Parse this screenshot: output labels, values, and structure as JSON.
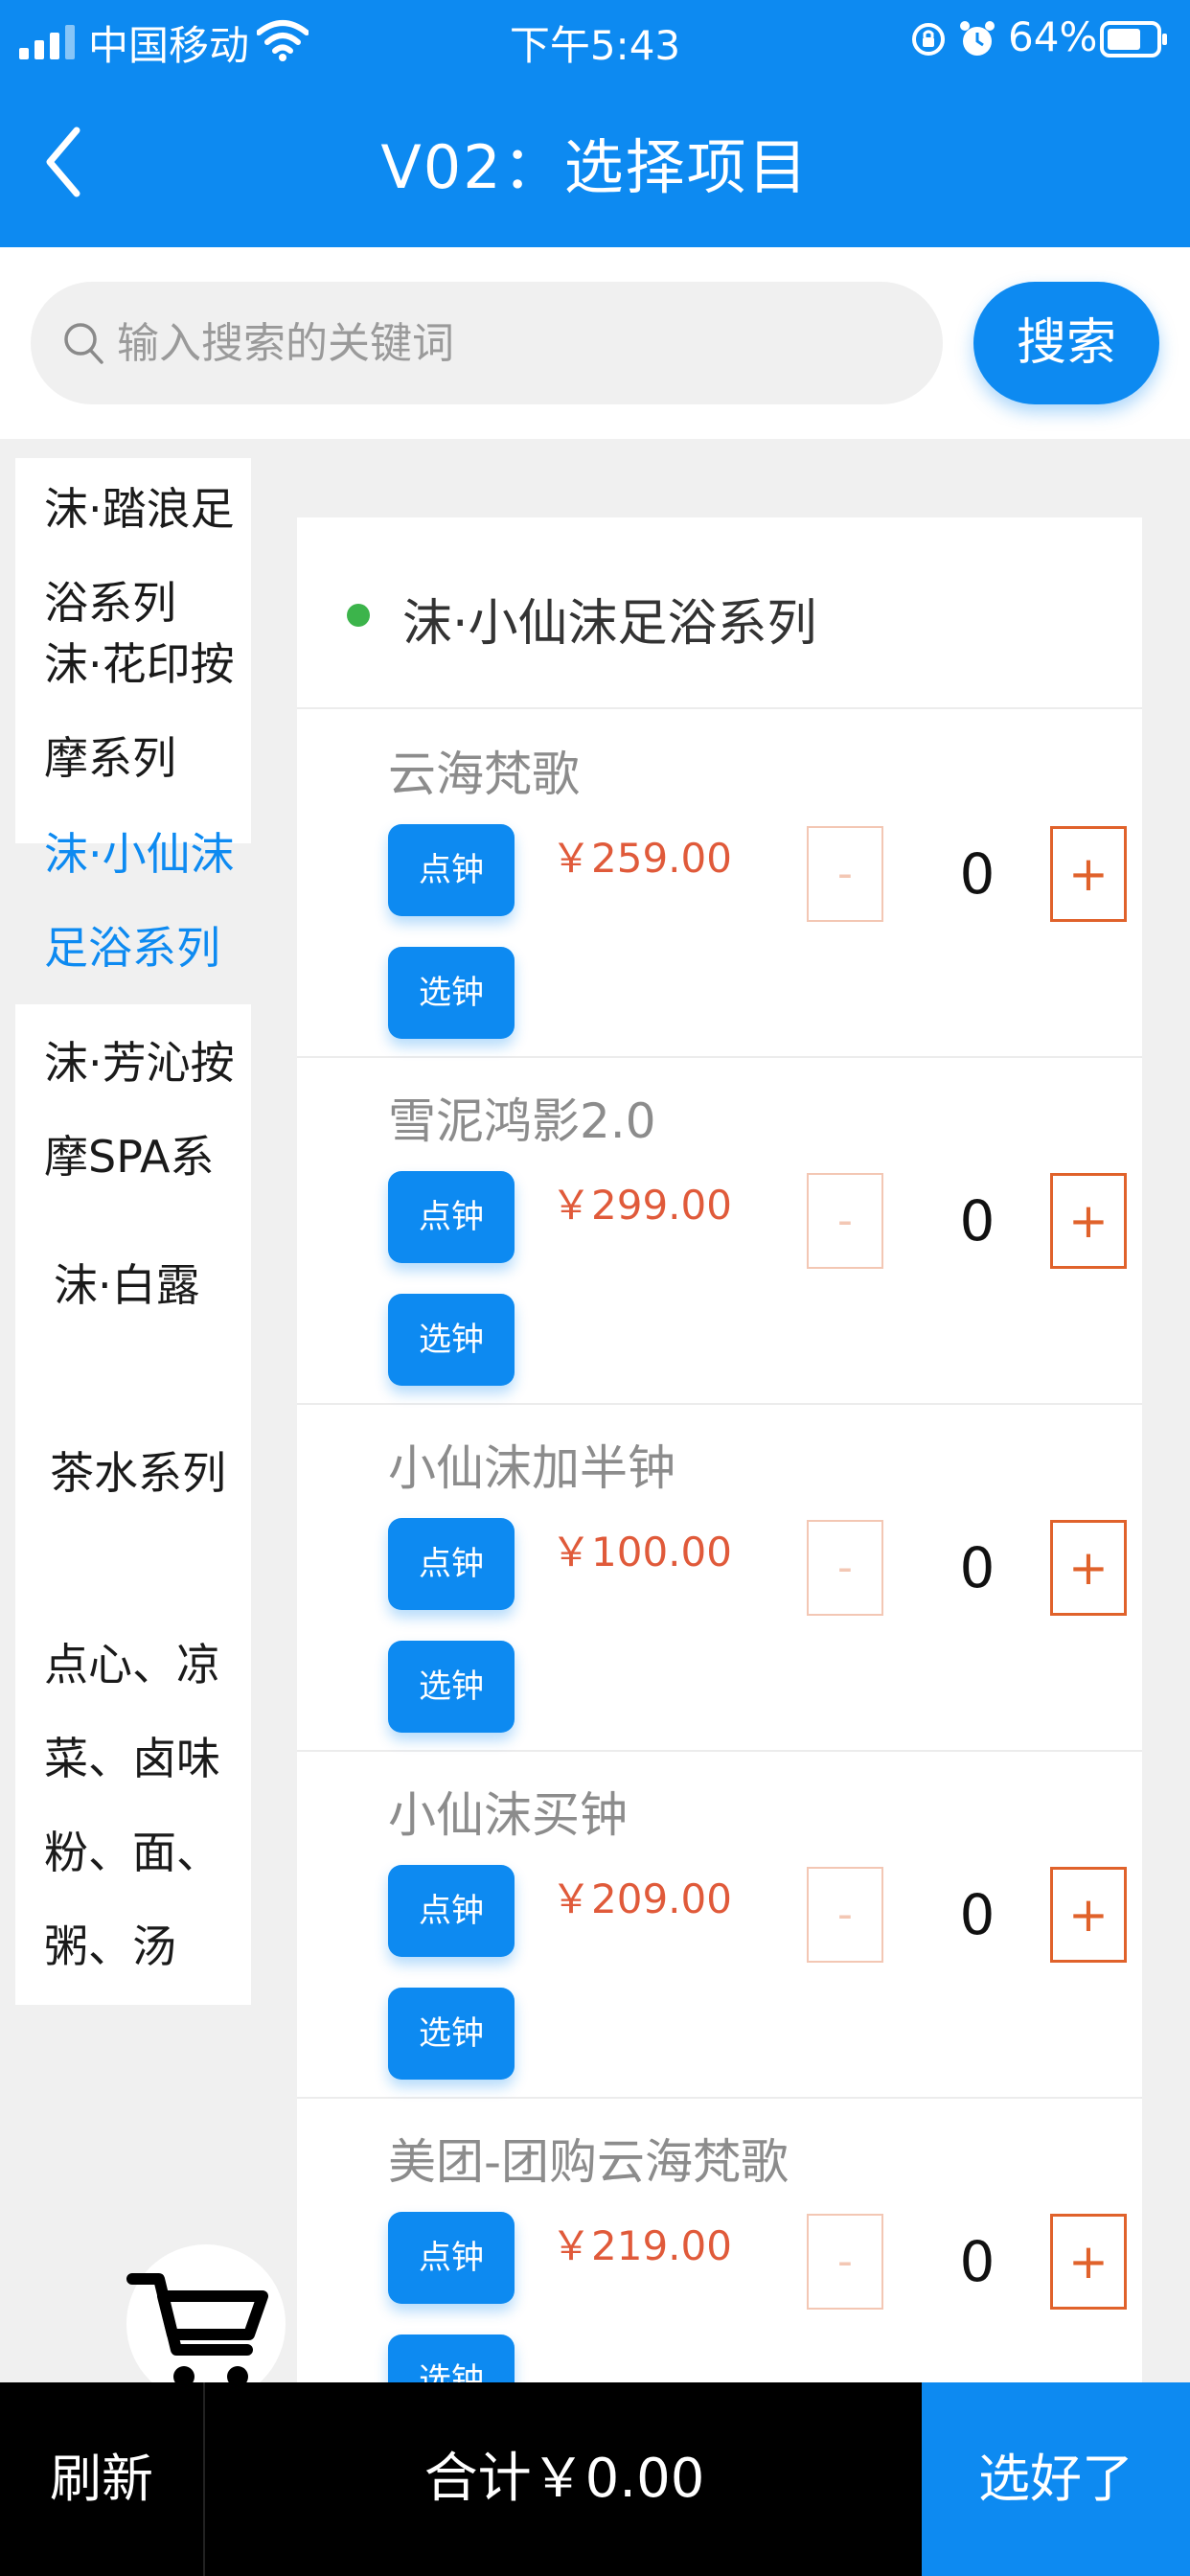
{
  "status_bar": {
    "carrier": "中国移动",
    "time": "下午5:43",
    "battery": "64%"
  },
  "header": {
    "title": "V02：选择项目"
  },
  "search": {
    "placeholder": "输入搜索的关键词",
    "value": "",
    "button_label": "搜索"
  },
  "categories": [
    {
      "label": "沫·踏浪足浴系列",
      "active": false
    },
    {
      "label": "沫·花印按摩系列",
      "active": false
    },
    {
      "label": "沫·小仙沫足浴系列",
      "active": true
    },
    {
      "label": "沫·芳沁按摩SPA系列",
      "active": false
    },
    {
      "label": "沫·白露",
      "active": false
    },
    {
      "label": "茶水系列",
      "active": false
    },
    {
      "label": "点心、凉菜、卤味粉、面、粥、汤",
      "active": false
    }
  ],
  "group": {
    "title": "沫·小仙沫足浴系列"
  },
  "items": [
    {
      "name": "云海梵歌",
      "price": "￥259.00",
      "qty": "0"
    },
    {
      "name": "雪泥鸿影2.0",
      "price": "￥299.00",
      "qty": "0"
    },
    {
      "name": "小仙沫加半钟",
      "price": "￥100.00",
      "qty": "0"
    },
    {
      "name": "小仙沫买钟",
      "price": "￥209.00",
      "qty": "0"
    },
    {
      "name": "美团-团购云海梵歌",
      "price": "￥219.00",
      "qty": "0"
    }
  ],
  "item_buttons": {
    "point_clock": "点钟",
    "pick_clock": "选钟",
    "minus": "-",
    "plus": "+"
  },
  "bottom_bar": {
    "refresh": "刷新",
    "total": "合计￥0.00",
    "confirm": "选好了"
  },
  "colors": {
    "primary": "#0d8af1",
    "price": "#e05a3a",
    "plus": "#e0622b",
    "group_dot": "#3cb44b"
  }
}
